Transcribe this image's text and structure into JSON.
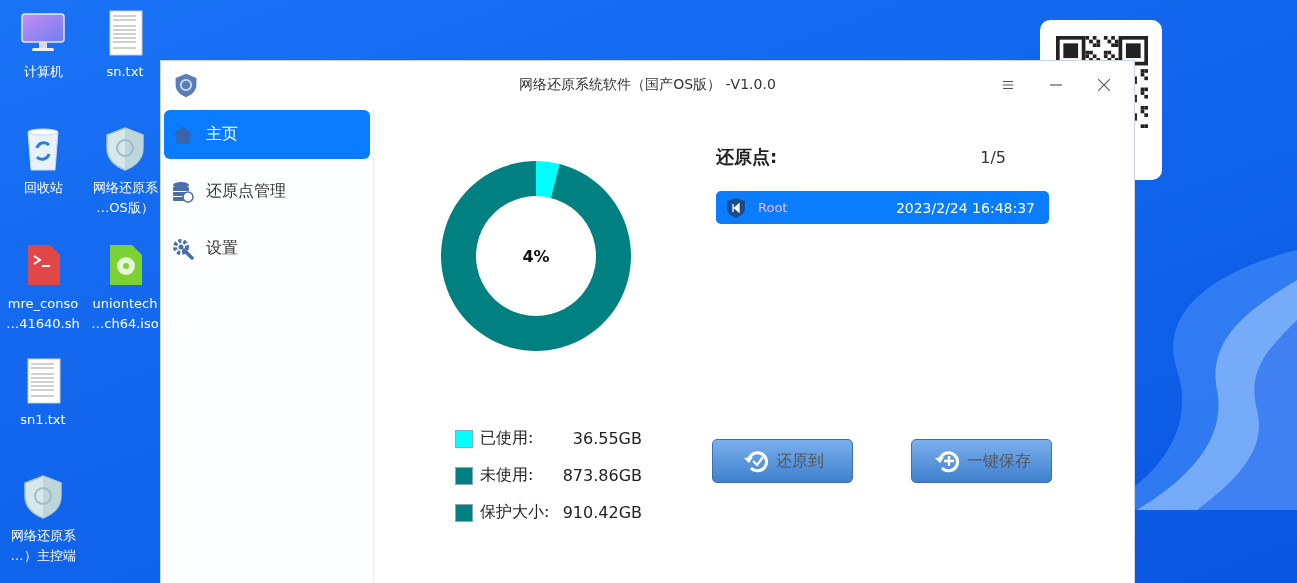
{
  "desktop": {
    "icons": [
      {
        "kind": "computer",
        "label_lines": [
          "计算机"
        ]
      },
      {
        "kind": "trash",
        "label_lines": [
          "回收站"
        ]
      },
      {
        "kind": "script",
        "label_lines": [
          "mre_conso",
          "…41640.sh"
        ]
      },
      {
        "kind": "text-file",
        "label_lines": [
          "sn1.txt"
        ]
      },
      {
        "kind": "shield",
        "label_lines": [
          "网络还原系",
          "…）主控端"
        ]
      },
      {
        "kind": "text-file",
        "label_lines": [
          "sn.txt"
        ]
      },
      {
        "kind": "shield",
        "label_lines": [
          "网络还原系",
          "…OS版）"
        ]
      },
      {
        "kind": "disc-file",
        "label_lines": [
          "uniontech",
          "…ch64.iso"
        ]
      }
    ]
  },
  "window": {
    "title": "网络还原系统软件（国产OS版） -V1.0.0"
  },
  "sidebar": {
    "items": [
      {
        "kind": "home",
        "label": "主页",
        "selected": true
      },
      {
        "kind": "database",
        "label": "还原点管理",
        "selected": false
      },
      {
        "kind": "settings",
        "label": "设置",
        "selected": false
      }
    ]
  },
  "disk": {
    "center_label": "4%",
    "chart_data": {
      "type": "donut",
      "values": [
        4,
        96
      ]
    },
    "legend": [
      {
        "label": "已使用:",
        "value": "36.55GB",
        "color": "#00ffff"
      },
      {
        "label": "未使用:",
        "value": "873.86GB",
        "color": "#008080"
      },
      {
        "label": "保护大小:",
        "value": "910.42GB",
        "color": "#008080"
      }
    ]
  },
  "restore_points": {
    "title": "还原点:",
    "count": "1/5",
    "items": [
      {
        "name": "Root",
        "time": "2023/2/24 16:48:37",
        "selected": true
      }
    ]
  },
  "buttons": [
    {
      "kind": "restore",
      "label": "还原到"
    },
    {
      "kind": "save",
      "label": "一键保存"
    }
  ]
}
